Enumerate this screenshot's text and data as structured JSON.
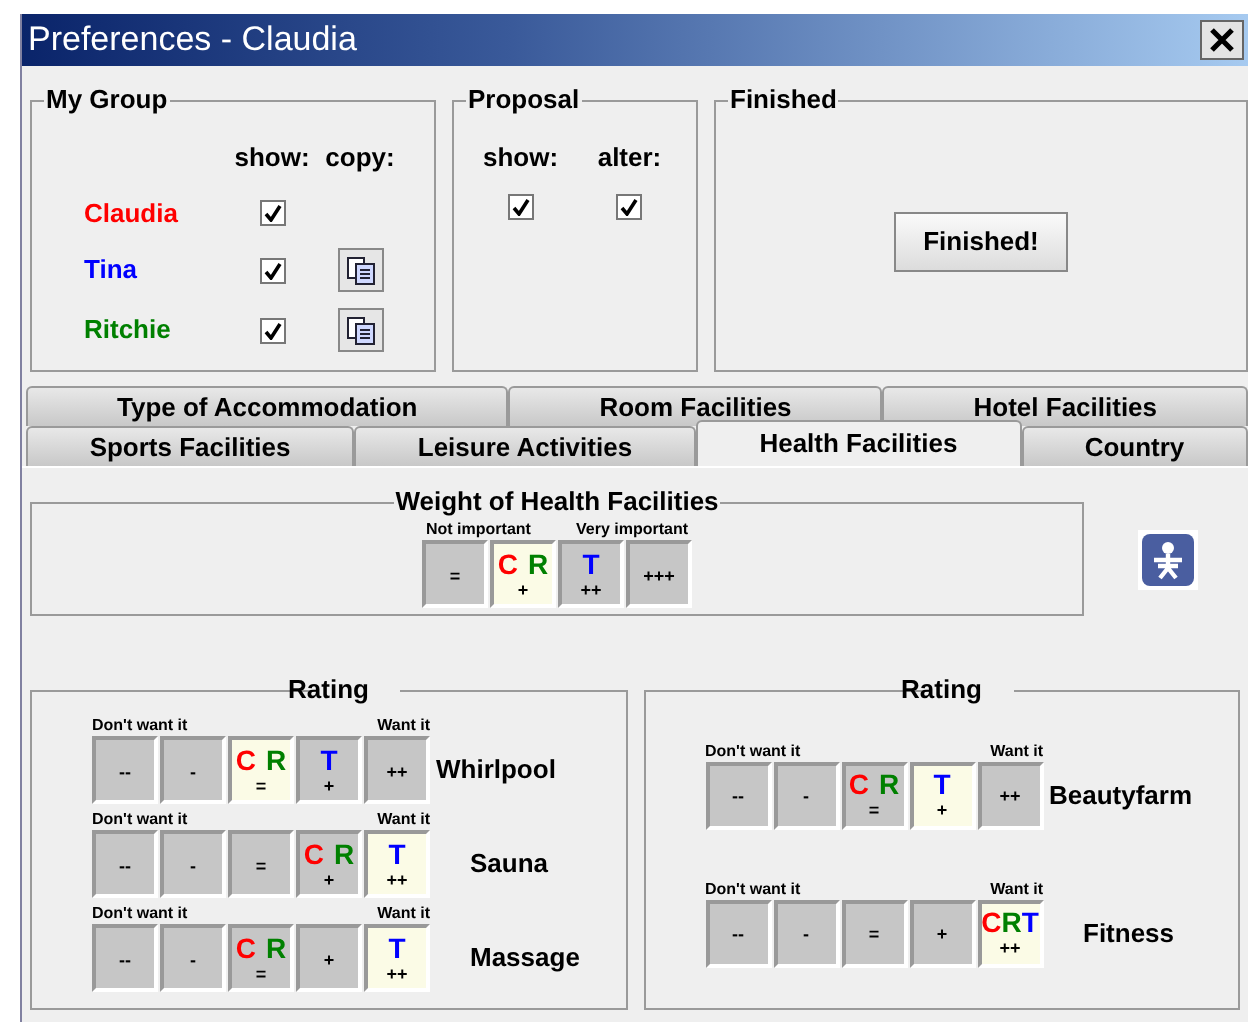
{
  "window": {
    "title": "Preferences - Claudia"
  },
  "my_group": {
    "title": "My Group",
    "columns": [
      "show:",
      "copy:"
    ],
    "members": [
      {
        "name": "Claudia",
        "color": "#ff0000",
        "show": true,
        "copy_button": false
      },
      {
        "name": "Tina",
        "color": "#0000ff",
        "show": true,
        "copy_button": true
      },
      {
        "name": "Ritchie",
        "color": "#008000",
        "show": true,
        "copy_button": true
      }
    ]
  },
  "proposal": {
    "title": "Proposal",
    "columns": [
      "show:",
      "alter:"
    ],
    "show": true,
    "alter": true
  },
  "finished": {
    "title": "Finished",
    "button": "Finished!"
  },
  "tab_rows": [
    [
      {
        "label": "Type of Accommodation",
        "selected": false
      },
      {
        "label": "Room Facilities",
        "selected": false
      },
      {
        "label": "Hotel Facilities",
        "selected": false
      }
    ],
    [
      {
        "label": "Sports Facilities",
        "selected": false
      },
      {
        "label": "Leisure Activities",
        "selected": false
      },
      {
        "label": "Health Facilities",
        "selected": true
      },
      {
        "label": "Country",
        "selected": false
      }
    ]
  ],
  "weight": {
    "title": "Weight of Health Facilities",
    "low_label": "Not important",
    "high_label": "Very important",
    "options": [
      {
        "value": "=",
        "selected": false
      },
      {
        "value": "+",
        "selected": true,
        "marks": [
          {
            "letter": "C",
            "color": "#ff0000"
          },
          {
            "letter": "R",
            "color": "#008000"
          }
        ]
      },
      {
        "value": "++",
        "selected": false,
        "marks": [
          {
            "letter": "T",
            "color": "#0000ff"
          }
        ]
      },
      {
        "value": "+++",
        "selected": false
      }
    ]
  },
  "ratings": [
    {
      "title": "Rating",
      "items": [
        {
          "name": "Whirlpool",
          "low_label": "Don't want it",
          "high_label": "Want it",
          "options": [
            {
              "value": "--",
              "selected": false
            },
            {
              "value": "-",
              "selected": false
            },
            {
              "value": "=",
              "selected": true,
              "marks": [
                {
                  "letter": "C",
                  "color": "#ff0000"
                },
                {
                  "letter": "R",
                  "color": "#008000"
                }
              ]
            },
            {
              "value": "+",
              "selected": false,
              "marks": [
                {
                  "letter": "T",
                  "color": "#0000ff"
                }
              ]
            },
            {
              "value": "++",
              "selected": false
            }
          ]
        },
        {
          "name": "Sauna",
          "low_label": "Don't want it",
          "high_label": "Want it",
          "options": [
            {
              "value": "--",
              "selected": false
            },
            {
              "value": "-",
              "selected": false
            },
            {
              "value": "=",
              "selected": false
            },
            {
              "value": "+",
              "selected": false,
              "marks": [
                {
                  "letter": "C",
                  "color": "#ff0000"
                },
                {
                  "letter": "R",
                  "color": "#008000"
                }
              ]
            },
            {
              "value": "++",
              "selected": true,
              "marks": [
                {
                  "letter": "T",
                  "color": "#0000ff"
                }
              ]
            }
          ]
        },
        {
          "name": "Massage",
          "low_label": "Don't want it",
          "high_label": "Want it",
          "options": [
            {
              "value": "--",
              "selected": false
            },
            {
              "value": "-",
              "selected": false
            },
            {
              "value": "=",
              "selected": false,
              "marks": [
                {
                  "letter": "C",
                  "color": "#ff0000"
                },
                {
                  "letter": "R",
                  "color": "#008000"
                }
              ]
            },
            {
              "value": "+",
              "selected": false
            },
            {
              "value": "++",
              "selected": true,
              "marks": [
                {
                  "letter": "T",
                  "color": "#0000ff"
                }
              ]
            }
          ]
        }
      ]
    },
    {
      "title": "Rating",
      "items": [
        {
          "name": "Beautyfarm",
          "low_label": "Don't want it",
          "high_label": "Want it",
          "options": [
            {
              "value": "--",
              "selected": false
            },
            {
              "value": "-",
              "selected": false
            },
            {
              "value": "=",
              "selected": false,
              "marks": [
                {
                  "letter": "C",
                  "color": "#ff0000"
                },
                {
                  "letter": "R",
                  "color": "#008000"
                }
              ]
            },
            {
              "value": "+",
              "selected": true,
              "marks": [
                {
                  "letter": "T",
                  "color": "#0000ff"
                }
              ]
            },
            {
              "value": "++",
              "selected": false
            }
          ]
        },
        {
          "name": "Fitness",
          "low_label": "Don't want it",
          "high_label": "Want it",
          "options": [
            {
              "value": "--",
              "selected": false
            },
            {
              "value": "-",
              "selected": false
            },
            {
              "value": "=",
              "selected": false
            },
            {
              "value": "+",
              "selected": false
            },
            {
              "value": "++",
              "selected": true,
              "marks": [
                {
                  "letter": "C",
                  "color": "#ff0000"
                },
                {
                  "letter": "R",
                  "color": "#008000"
                },
                {
                  "letter": "T",
                  "color": "#0000ff"
                }
              ]
            }
          ]
        }
      ]
    }
  ]
}
